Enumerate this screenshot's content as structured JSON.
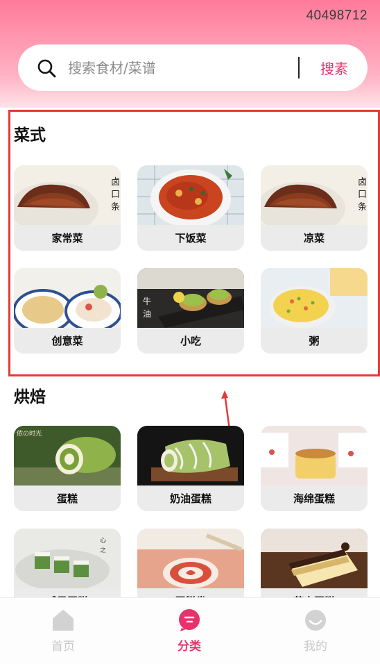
{
  "status": {
    "id_text": "40498712"
  },
  "search": {
    "placeholder": "搜索食材/菜谱",
    "button_label": "搜素"
  },
  "sections": [
    {
      "title": "菜式",
      "items": [
        {
          "label": "家常菜",
          "image": "braised-meat-platter"
        },
        {
          "label": "下饭菜",
          "image": "spicy-stir-fry-bowl"
        },
        {
          "label": "凉菜",
          "image": "braised-meat-platter"
        },
        {
          "label": "创意菜",
          "image": "soup-bowls"
        },
        {
          "label": "小吃",
          "image": "avocado-toast"
        },
        {
          "label": "粥",
          "image": "vegetable-pancake"
        }
      ]
    },
    {
      "title": "烘焙",
      "items": [
        {
          "label": "蛋糕",
          "image": "matcha-roll"
        },
        {
          "label": "奶油蛋糕",
          "image": "matcha-cream-roll"
        },
        {
          "label": "海绵蛋糕",
          "image": "sponge-cake"
        },
        {
          "label": "戚风蛋糕",
          "image": "matcha-squares"
        },
        {
          "label": "蛋糕卷",
          "image": "red-roll"
        },
        {
          "label": "芝士蛋糕",
          "image": "layer-cake"
        }
      ]
    }
  ],
  "bottom_nav": [
    {
      "label": "首页",
      "icon": "home-icon",
      "active": false
    },
    {
      "label": "分类",
      "icon": "category-icon",
      "active": true
    },
    {
      "label": "我的",
      "icon": "profile-icon",
      "active": false
    }
  ],
  "colors": {
    "accent": "#e5336b",
    "highlight": "#e53935",
    "header_top": "#ff7a9a"
  }
}
